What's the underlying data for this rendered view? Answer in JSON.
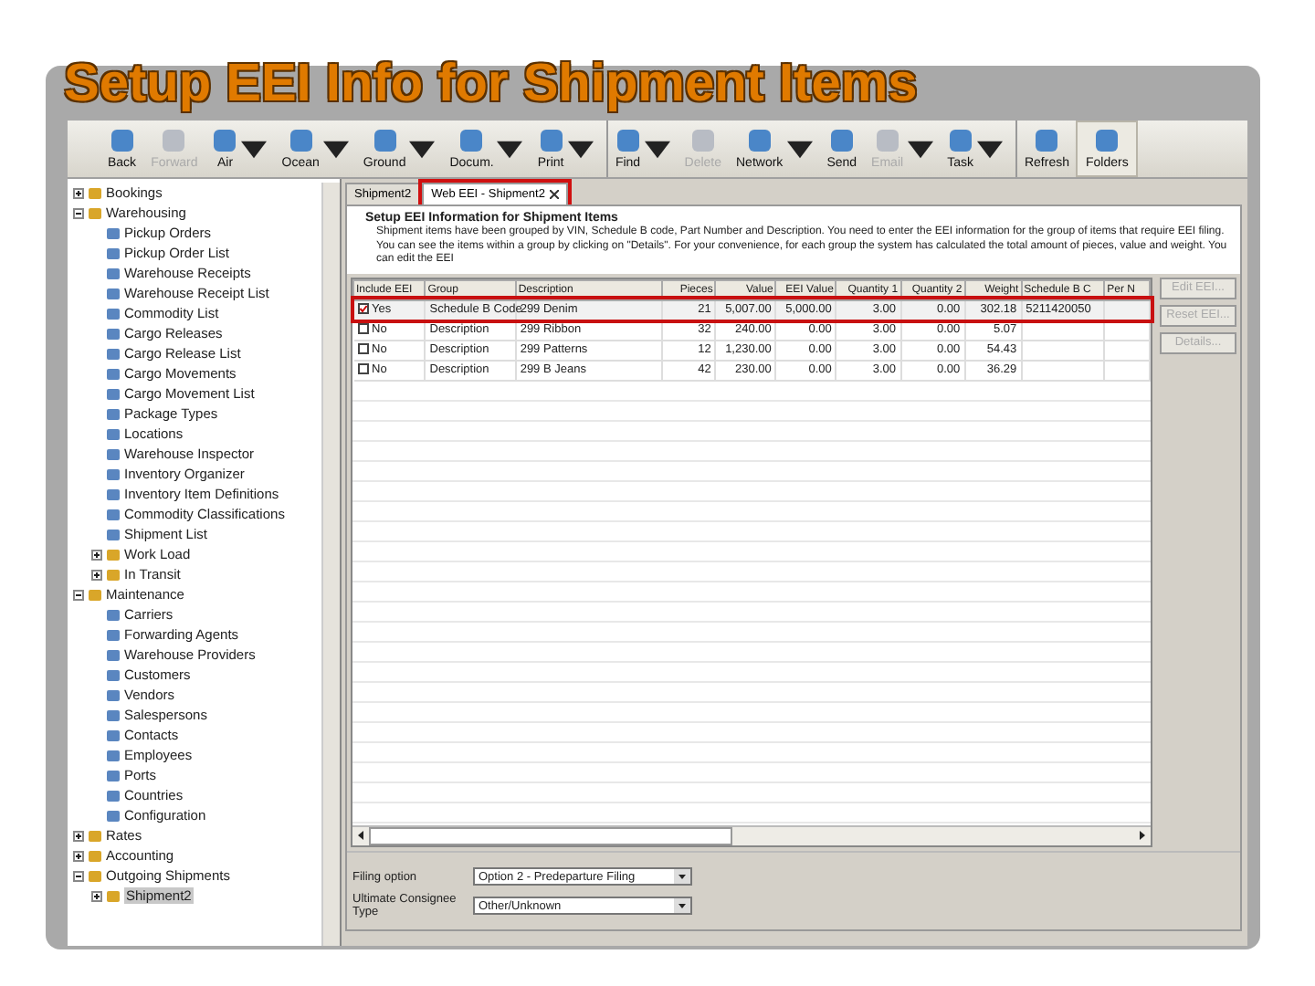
{
  "title": "Setup EEI Info for Shipment Items",
  "toolbar": [
    {
      "label": "Back",
      "disabled": false,
      "dropdown": false,
      "selected": false,
      "group_start": false
    },
    {
      "label": "Forward",
      "disabled": true,
      "dropdown": false,
      "selected": false,
      "group_start": false
    },
    {
      "label": "Air",
      "disabled": false,
      "dropdown": true,
      "selected": false,
      "group_start": false
    },
    {
      "label": "Ocean",
      "disabled": false,
      "dropdown": true,
      "selected": false,
      "group_start": false
    },
    {
      "label": "Ground",
      "disabled": false,
      "dropdown": true,
      "selected": false,
      "group_start": false
    },
    {
      "label": "Docum.",
      "disabled": false,
      "dropdown": true,
      "selected": false,
      "group_start": false
    },
    {
      "label": "Print",
      "disabled": false,
      "dropdown": true,
      "selected": false,
      "group_start": false
    },
    {
      "label": "Find",
      "disabled": false,
      "dropdown": true,
      "selected": false,
      "group_start": true
    },
    {
      "label": "Delete",
      "disabled": true,
      "dropdown": false,
      "selected": false,
      "group_start": false
    },
    {
      "label": "Network",
      "disabled": false,
      "dropdown": true,
      "selected": false,
      "group_start": false
    },
    {
      "label": "Send",
      "disabled": false,
      "dropdown": false,
      "selected": false,
      "group_start": false
    },
    {
      "label": "Email",
      "disabled": true,
      "dropdown": true,
      "selected": false,
      "group_start": false
    },
    {
      "label": "Task",
      "disabled": false,
      "dropdown": true,
      "selected": false,
      "group_start": false
    },
    {
      "label": "Refresh",
      "disabled": false,
      "dropdown": false,
      "selected": false,
      "group_start": true
    },
    {
      "label": "Folders",
      "disabled": false,
      "dropdown": false,
      "selected": true,
      "group_start": false
    }
  ],
  "tree": [
    {
      "label": "Bookings",
      "kind": "branch",
      "expanded": false,
      "selected": false
    },
    {
      "label": "Warehousing",
      "kind": "branch",
      "expanded": true,
      "selected": false,
      "children": [
        {
          "label": "Pickup Orders",
          "kind": "leaf",
          "selected": false
        },
        {
          "label": "Pickup Order List",
          "kind": "leaf",
          "selected": false
        },
        {
          "label": "Warehouse Receipts",
          "kind": "leaf",
          "selected": false
        },
        {
          "label": "Warehouse Receipt List",
          "kind": "leaf",
          "selected": false
        },
        {
          "label": "Commodity List",
          "kind": "leaf",
          "selected": false
        },
        {
          "label": "Cargo Releases",
          "kind": "leaf",
          "selected": false
        },
        {
          "label": "Cargo Release List",
          "kind": "leaf",
          "selected": false
        },
        {
          "label": "Cargo Movements",
          "kind": "leaf",
          "selected": false
        },
        {
          "label": "Cargo Movement List",
          "kind": "leaf",
          "selected": false
        },
        {
          "label": "Package Types",
          "kind": "leaf",
          "selected": false
        },
        {
          "label": "Locations",
          "kind": "leaf",
          "selected": false
        },
        {
          "label": "Warehouse Inspector",
          "kind": "leaf",
          "selected": false
        },
        {
          "label": "Inventory Organizer",
          "kind": "leaf",
          "selected": false
        },
        {
          "label": "Inventory Item Definitions",
          "kind": "leaf",
          "selected": false
        },
        {
          "label": "Commodity Classifications",
          "kind": "leaf",
          "selected": false
        },
        {
          "label": "Shipment List",
          "kind": "leaf",
          "selected": false
        },
        {
          "label": "Work Load",
          "kind": "branch",
          "expanded": false,
          "selected": false
        },
        {
          "label": "In Transit",
          "kind": "branch",
          "expanded": false,
          "selected": false
        }
      ]
    },
    {
      "label": "Maintenance",
      "kind": "branch",
      "expanded": true,
      "selected": false,
      "children": [
        {
          "label": "Carriers",
          "kind": "leaf",
          "selected": false
        },
        {
          "label": "Forwarding Agents",
          "kind": "leaf",
          "selected": false
        },
        {
          "label": "Warehouse Providers",
          "kind": "leaf",
          "selected": false
        },
        {
          "label": "Customers",
          "kind": "leaf",
          "selected": false
        },
        {
          "label": "Vendors",
          "kind": "leaf",
          "selected": false
        },
        {
          "label": "Salespersons",
          "kind": "leaf",
          "selected": false
        },
        {
          "label": "Contacts",
          "kind": "leaf",
          "selected": false
        },
        {
          "label": "Employees",
          "kind": "leaf",
          "selected": false
        },
        {
          "label": "Ports",
          "kind": "leaf",
          "selected": false
        },
        {
          "label": "Countries",
          "kind": "leaf",
          "selected": false
        },
        {
          "label": "Configuration",
          "kind": "leaf",
          "selected": false
        }
      ]
    },
    {
      "label": "Rates",
      "kind": "branch",
      "expanded": false,
      "selected": false
    },
    {
      "label": "Accounting",
      "kind": "branch",
      "expanded": false,
      "selected": false
    },
    {
      "label": "Outgoing Shipments",
      "kind": "branch",
      "expanded": true,
      "selected": false,
      "children": [
        {
          "label": "Shipment2",
          "kind": "branch",
          "expanded": false,
          "selected": true
        }
      ]
    }
  ],
  "tabs": [
    {
      "label": "Shipment2",
      "selected": false,
      "closable": false,
      "highlighted": false
    },
    {
      "label": "Web EEI - Shipment2",
      "selected": true,
      "closable": true,
      "highlighted": true
    }
  ],
  "heading": "Setup EEI Information for Shipment Items",
  "description": "Shipment items have been grouped by VIN, Schedule B code, Part Number and Description. You need to enter the EEI information for the group of items that require EEI filing. You can see the items within a group by clicking on \"Details\". For your convenience, for each group the system has calculated the total amount of pieces, value and weight. You can edit the EEI",
  "table": {
    "columns": [
      "Include EEI",
      "Group",
      "Description",
      "Pieces",
      "Value",
      "EEI Value",
      "Quantity 1",
      "Quantity 2",
      "Weight",
      "Schedule B C",
      "Per N"
    ],
    "rows": [
      {
        "checked": true,
        "selected": true,
        "highlighted": true,
        "cells": [
          "Yes",
          "Schedule B Code",
          "299 Denim",
          "21",
          "5,007.00",
          "5,000.00",
          "3.00",
          "0.00",
          "302.18",
          "5211420050",
          ""
        ]
      },
      {
        "checked": false,
        "selected": false,
        "highlighted": false,
        "cells": [
          "No",
          "Description",
          "299 Ribbon",
          "32",
          "240.00",
          "0.00",
          "3.00",
          "0.00",
          "5.07",
          "",
          ""
        ]
      },
      {
        "checked": false,
        "selected": false,
        "highlighted": false,
        "cells": [
          "No",
          "Description",
          "299 Patterns",
          "12",
          "1,230.00",
          "0.00",
          "3.00",
          "0.00",
          "54.43",
          "",
          ""
        ]
      },
      {
        "checked": false,
        "selected": false,
        "highlighted": false,
        "cells": [
          "No",
          "Description",
          "299 B Jeans",
          "42",
          "230.00",
          "0.00",
          "3.00",
          "0.00",
          "36.29",
          "",
          ""
        ]
      }
    ]
  },
  "side_buttons": [
    {
      "label": "Edit EEI...",
      "disabled": true
    },
    {
      "label": "Reset EEI...",
      "disabled": true
    },
    {
      "label": "Details...",
      "disabled": true
    }
  ],
  "form": [
    {
      "label": "Filing option",
      "value": "Option 2 - Predeparture Filing"
    },
    {
      "label": "Ultimate Consignee Type",
      "value": "Other/Unknown"
    }
  ]
}
